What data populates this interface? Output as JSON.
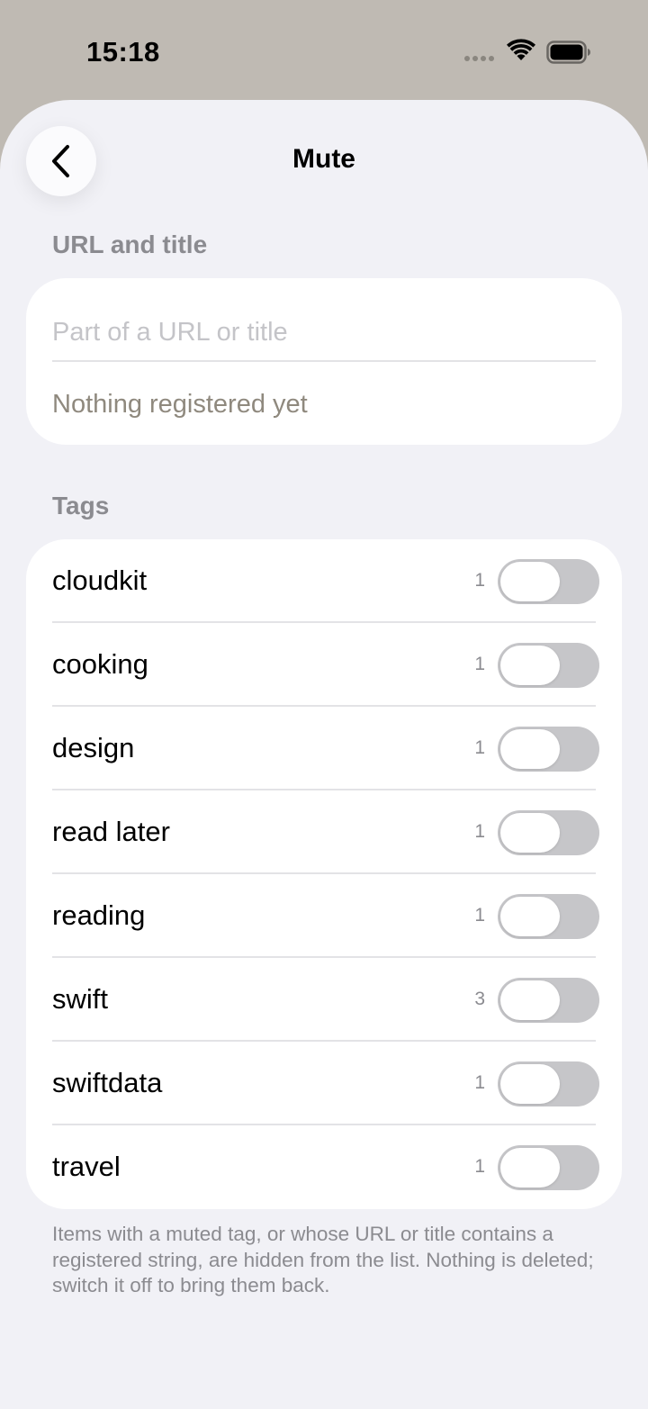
{
  "status_bar": {
    "time": "15:18"
  },
  "nav": {
    "title": "Mute"
  },
  "url_section": {
    "header": "URL and title",
    "input_placeholder": "Part of a URL or title",
    "input_value": "",
    "empty_text": "Nothing registered yet"
  },
  "tags_section": {
    "header": "Tags",
    "items": [
      {
        "label": "cloudkit",
        "count": "1",
        "muted": false
      },
      {
        "label": "cooking",
        "count": "1",
        "muted": false
      },
      {
        "label": "design",
        "count": "1",
        "muted": false
      },
      {
        "label": "read later",
        "count": "1",
        "muted": false
      },
      {
        "label": "reading",
        "count": "1",
        "muted": false
      },
      {
        "label": "swift",
        "count": "3",
        "muted": false
      },
      {
        "label": "swiftdata",
        "count": "1",
        "muted": false
      },
      {
        "label": "travel",
        "count": "1",
        "muted": false
      }
    ]
  },
  "footer": {
    "note": "Items with a muted tag, or whose URL or title contains a registered string, are hidden from the list. Nothing is deleted; switch it off to bring them back."
  },
  "colors": {
    "status_background": "#bfbab3",
    "sheet_background": "#f1f1f6",
    "toggle_off": "#c6c6c9",
    "secondary_text": "#8b8b90"
  }
}
